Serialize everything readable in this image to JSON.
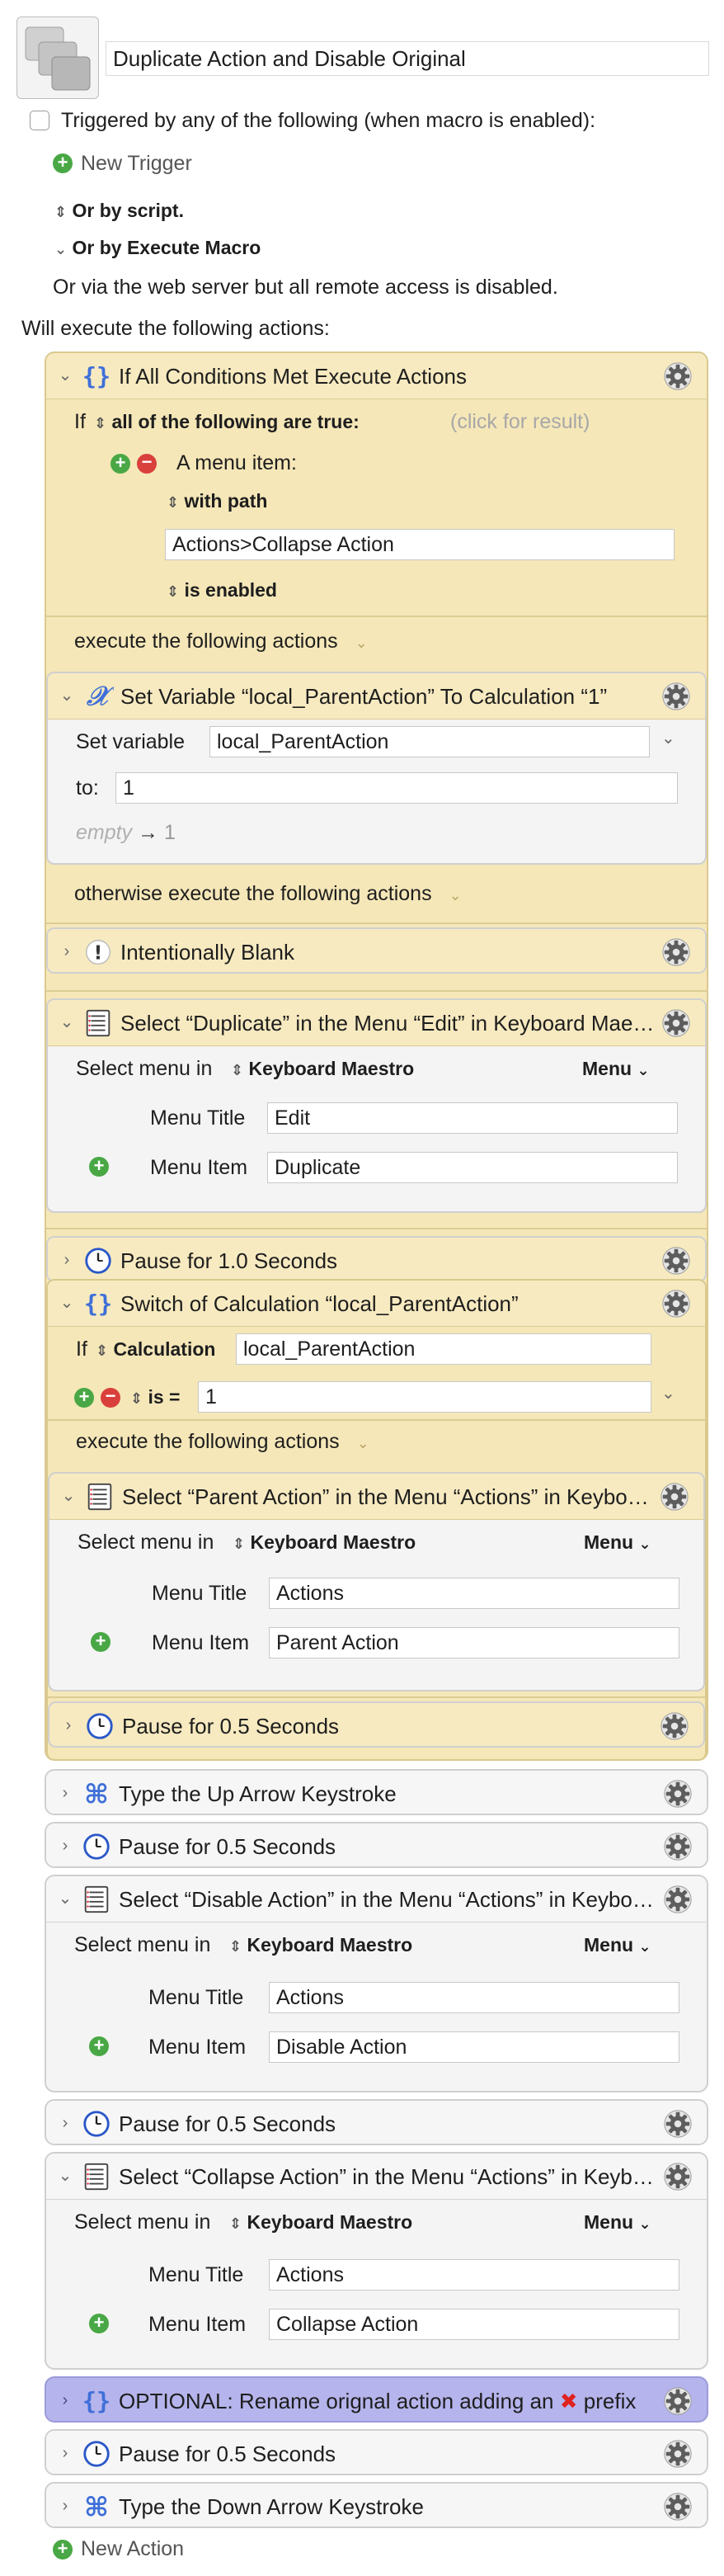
{
  "macro": {
    "name": "Duplicate Action and Disable Original",
    "triggered_label": "Triggered by any of the following (when macro is enabled):",
    "new_trigger": "New Trigger",
    "or_by_script": "Or by script.",
    "or_by_execute": "Or by Execute Macro",
    "or_via_web": "Or via the web server but all remote access is disabled.",
    "will_execute": "Will execute the following actions:",
    "new_action": "New Action"
  },
  "if_all": {
    "title": "If All Conditions Met Execute Actions",
    "if_label": "If",
    "all_true": "all of the following are true:",
    "click_result": "(click for result)",
    "menu_item": "A menu item:",
    "with_path": "with path",
    "path_value": "Actions>Collapse Action",
    "is_enabled": "is enabled",
    "execute_following": "execute the following actions",
    "otherwise": "otherwise execute the following actions"
  },
  "set_var": {
    "title": "Set Variable “local_ParentAction” To Calculation “1”",
    "set_label": "Set variable",
    "var_value": "local_ParentAction",
    "to_label": "to:",
    "to_value": "1",
    "empty": "empty",
    "result": "1"
  },
  "blank": {
    "title": "Intentionally Blank"
  },
  "sel_dup": {
    "title": "Select “Duplicate” in the Menu “Edit” in Keyboard Maestro",
    "select_menu_in": "Select menu in",
    "app": "Keyboard Maestro",
    "menu": "Menu",
    "menu_title_label": "Menu Title",
    "menu_title": "Edit",
    "menu_item_label": "Menu Item",
    "menu_item": "Duplicate"
  },
  "pause1": {
    "title": "Pause for 1.0 Seconds"
  },
  "switch": {
    "title": "Switch of Calculation “local_ParentAction”",
    "if_label": "If",
    "calc_label": "Calculation",
    "calc_value": "local_ParentAction",
    "is_label": "is =",
    "is_value": "1",
    "execute_following": "execute the following actions"
  },
  "sel_parent": {
    "title": "Select “Parent Action” in the Menu “Actions” in Keyboard Maestro",
    "select_menu_in": "Select menu in",
    "app": "Keyboard Maestro",
    "menu": "Menu",
    "menu_title_label": "Menu Title",
    "menu_title": "Actions",
    "menu_item_label": "Menu Item",
    "menu_item": "Parent Action"
  },
  "pause2": {
    "title": "Pause for 0.5 Seconds"
  },
  "type_up": {
    "title": "Type the Up Arrow Keystroke"
  },
  "pause3": {
    "title": "Pause for 0.5 Seconds"
  },
  "sel_disable": {
    "title": "Select “Disable Action” in the Menu “Actions” in Keyboard Maestro",
    "select_menu_in": "Select menu in",
    "app": "Keyboard Maestro",
    "menu": "Menu",
    "menu_title_label": "Menu Title",
    "menu_title": "Actions",
    "menu_item_label": "Menu Item",
    "menu_item": "Disable Action"
  },
  "pause4": {
    "title": "Pause for 0.5 Seconds"
  },
  "sel_collapse": {
    "title": "Select “Collapse Action” in the Menu “Actions” in Keyboard Maestro",
    "select_menu_in": "Select menu in",
    "app": "Keyboard Maestro",
    "menu": "Menu",
    "menu_title_label": "Menu Title",
    "menu_title": "Actions",
    "menu_item_label": "Menu Item",
    "menu_item": "Collapse Action"
  },
  "optional": {
    "title_pre": "OPTIONAL: Rename orignal action adding an",
    "title_post": "prefix"
  },
  "pause5": {
    "title": "Pause for 0.5 Seconds"
  },
  "type_down": {
    "title": "Type the Down Arrow Keystroke"
  },
  "colors": {
    "condition_bg": "#f5e7b8",
    "purple_bg": "#b5b4ec",
    "add_green": "#49a845",
    "remove_red": "#d9403c"
  }
}
